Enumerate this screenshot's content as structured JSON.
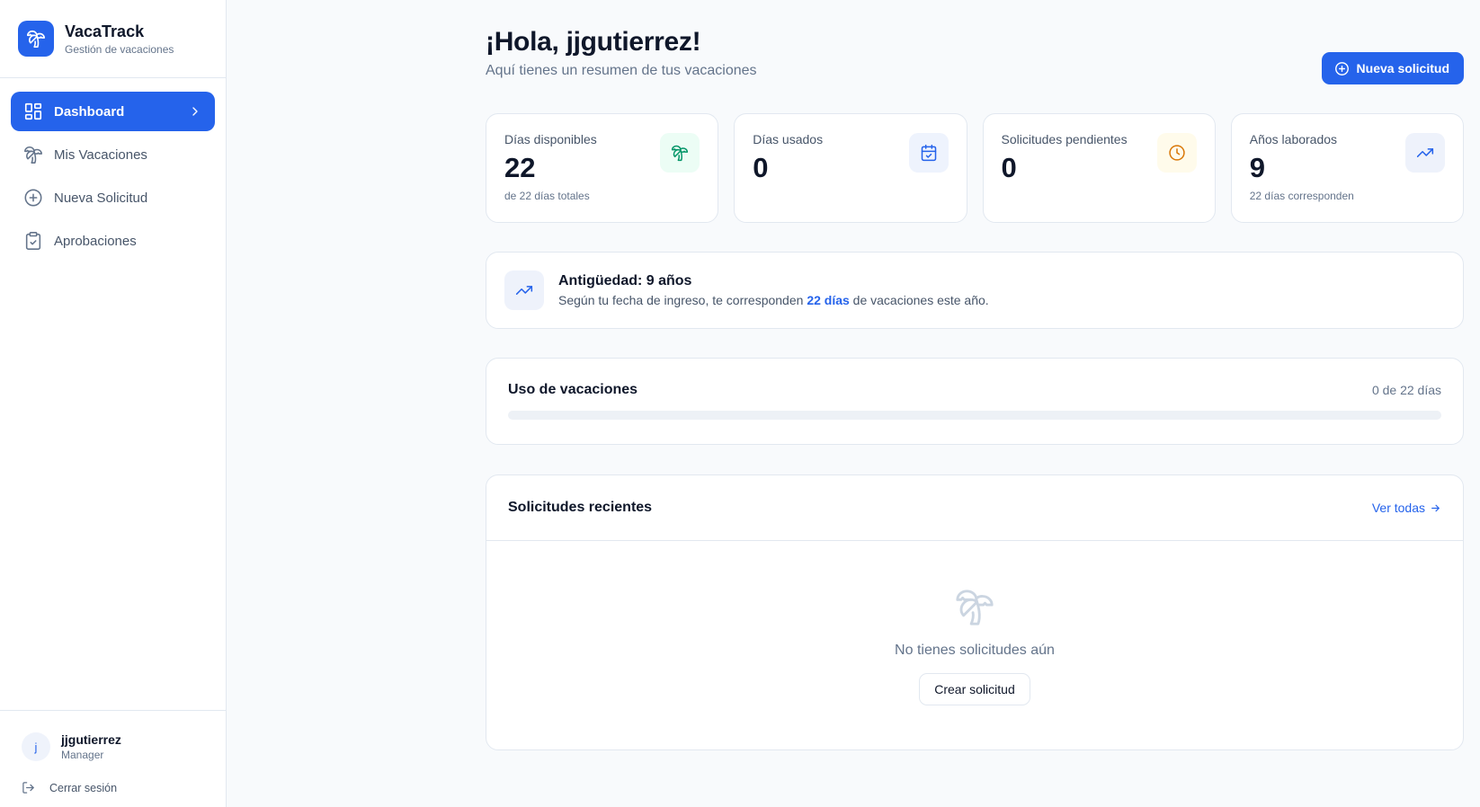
{
  "brand": {
    "title": "VacaTrack",
    "subtitle": "Gestión de vacaciones",
    "logo_icon": "palm-tree-icon",
    "accent": "#2563eb"
  },
  "sidebar": {
    "items": [
      {
        "label": "Dashboard",
        "icon": "dashboard-grid-icon",
        "active": true
      },
      {
        "label": "Mis Vacaciones",
        "icon": "palm-tree-icon",
        "active": false
      },
      {
        "label": "Nueva Solicitud",
        "icon": "plus-circle-icon",
        "active": false
      },
      {
        "label": "Aprobaciones",
        "icon": "clipboard-check-icon",
        "active": false
      }
    ]
  },
  "user": {
    "initial": "j",
    "name": "jjgutierrez",
    "role": "Manager",
    "logout_label": "Cerrar sesión"
  },
  "header": {
    "greeting": "¡Hola, jjgutierrez!",
    "subtitle": "Aquí tienes un resumen de tus vacaciones",
    "new_request_label": "Nueva solicitud"
  },
  "stats": [
    {
      "label": "Días disponibles",
      "value": "22",
      "note": "de 22 días totales",
      "icon": "palm-tree-icon",
      "icon_color": "#059669",
      "icon_bg": "#ecfdf5"
    },
    {
      "label": "Días usados",
      "value": "0",
      "note": "",
      "icon": "calendar-check-icon",
      "icon_color": "#2563eb",
      "icon_bg": "#eff6ff"
    },
    {
      "label": "Solicitudes pendientes",
      "value": "0",
      "note": "",
      "icon": "clock-icon",
      "icon_color": "#d97706",
      "icon_bg": "#fffbeb"
    },
    {
      "label": "Años laborados",
      "value": "9",
      "note": "22 días corresponden",
      "icon": "trending-up-icon",
      "icon_color": "#2563eb",
      "icon_bg": "#eef2fb"
    }
  ],
  "seniority": {
    "title": "Antigüedad: 9 años",
    "text_before": "Según tu fecha de ingreso, te corresponden ",
    "highlight": "22 días",
    "text_after": " de vacaciones este año."
  },
  "usage": {
    "title": "Uso de vacaciones",
    "count_label": "0 de 22 días",
    "used": 0,
    "total": 22
  },
  "recent": {
    "title": "Solicitudes recientes",
    "view_all_label": "Ver todas",
    "empty_text": "No tienes solicitudes aún",
    "create_label": "Crear solicitud"
  }
}
